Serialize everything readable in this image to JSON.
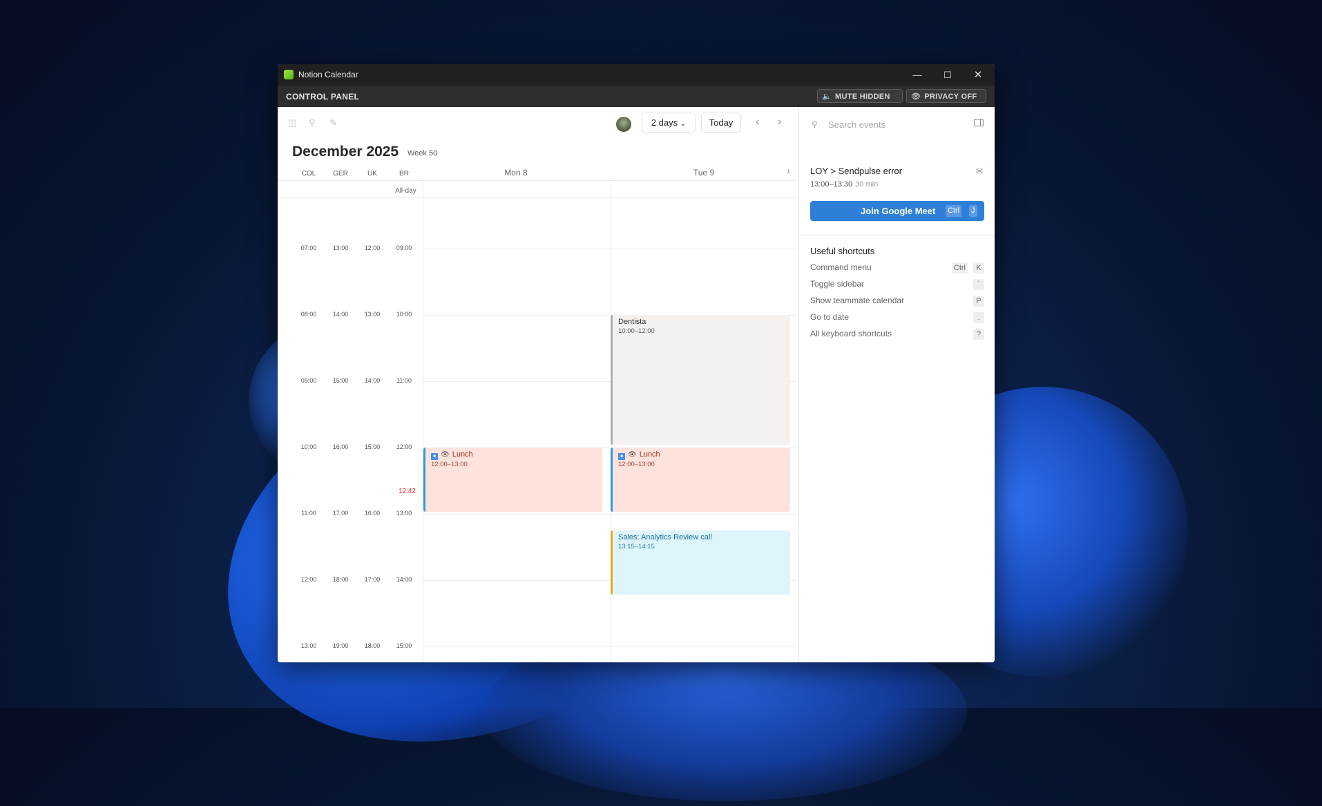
{
  "window": {
    "title": "Notion Calendar"
  },
  "control_panel": {
    "title": "CONTROL PANEL",
    "mute_label": "MUTE HIDDEN",
    "privacy_label": "PRIVACY OFF"
  },
  "toolbar": {
    "range_label": "2 days",
    "today_label": "Today"
  },
  "calendar": {
    "month": "December 2025",
    "week": "Week 50",
    "timezones": [
      "COL",
      "GER",
      "UK",
      "BR"
    ],
    "days": [
      "Mon 8",
      "Tue 9"
    ],
    "allday_label": "All-day",
    "current_time": "12:42",
    "time_rows": [
      [
        "07:00",
        "13:00",
        "12:00",
        "09:00"
      ],
      [
        "08:00",
        "14:00",
        "13:00",
        "10:00"
      ],
      [
        "09:00",
        "15:00",
        "14:00",
        "11:00"
      ],
      [
        "10:00",
        "16:00",
        "15:00",
        "12:00"
      ],
      [
        "11:00",
        "17:00",
        "16:00",
        "13:00"
      ],
      [
        "12:00",
        "18:00",
        "17:00",
        "14:00"
      ],
      [
        "13:00",
        "19:00",
        "18:00",
        "15:00"
      ]
    ]
  },
  "events": {
    "mon_lunch": {
      "title": "Lunch",
      "time": "12:00–13:00"
    },
    "tue_dentista": {
      "title": "Dentista",
      "time": "10:00–12:00"
    },
    "tue_lunch": {
      "title": "Lunch",
      "time": "12:00–13:00"
    },
    "tue_sales": {
      "title": "Sales: Analytics Review call",
      "time": "13:15–14:15"
    }
  },
  "sidebar": {
    "search_placeholder": "Search events",
    "event_title": "LOY > Sendpulse error",
    "event_time": "13:00–13:30",
    "event_duration": "30 min",
    "join_label": "Join Google Meet",
    "join_keys": [
      "Ctrl",
      "J"
    ],
    "shortcuts_title": "Useful shortcuts",
    "shortcuts": [
      {
        "label": "Command menu",
        "keys": [
          "Ctrl",
          "K"
        ]
      },
      {
        "label": "Toggle sidebar",
        "keys": [
          "`"
        ]
      },
      {
        "label": "Show teammate calendar",
        "keys": [
          "P"
        ]
      },
      {
        "label": "Go to date",
        "keys": [
          "."
        ]
      },
      {
        "label": "All keyboard shortcuts",
        "keys": [
          "?"
        ]
      }
    ]
  },
  "colors": {
    "accent": "#2e7fd8",
    "lunch_bg": "#fde3dc",
    "dentista_bg": "#f5f1ef",
    "sales_bg": "#def6fb",
    "now_indicator": "#e03030"
  }
}
